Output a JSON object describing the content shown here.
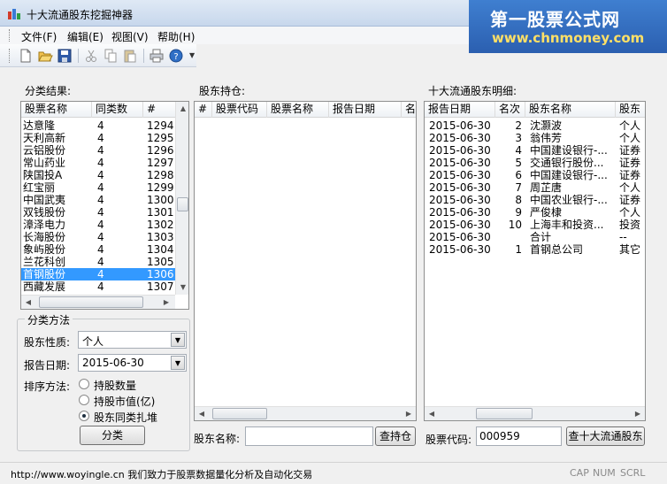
{
  "window": {
    "title": "十大流通股东挖掘神器"
  },
  "watermark": {
    "title": "第一股票公式网",
    "url": "www.chnmoney.com"
  },
  "menu": [
    "文件(F)",
    "编辑(E)",
    "视图(V)",
    "帮助(H)"
  ],
  "toolbar": {
    "icons": [
      "new-file-icon",
      "open-folder-icon",
      "save-icon",
      "cut-icon",
      "copy-icon",
      "paste-icon",
      "print-icon",
      "help-icon"
    ]
  },
  "classification": {
    "title": "分类结果:",
    "columns": [
      "股票名称",
      "同类数",
      "#"
    ],
    "rows": [
      [
        "达意隆",
        "4",
        "1294"
      ],
      [
        "天利高新",
        "4",
        "1295"
      ],
      [
        "云铝股份",
        "4",
        "1296"
      ],
      [
        "常山药业",
        "4",
        "1297"
      ],
      [
        "陕国投A",
        "4",
        "1298"
      ],
      [
        "红宝丽",
        "4",
        "1299"
      ],
      [
        "中国武夷",
        "4",
        "1300"
      ],
      [
        "双钱股份",
        "4",
        "1301"
      ],
      [
        "漳泽电力",
        "4",
        "1302"
      ],
      [
        "长海股份",
        "4",
        "1303"
      ],
      [
        "象屿股份",
        "4",
        "1304"
      ],
      [
        "兰花科创",
        "4",
        "1305"
      ],
      [
        "首钢股份",
        "4",
        "1306"
      ],
      [
        "西藏发展",
        "4",
        "1307"
      ]
    ],
    "selected_index": 12
  },
  "method": {
    "title": "分类方法",
    "nature_label": "股东性质:",
    "nature_value": "个人",
    "date_label": "报告日期:",
    "date_value": "2015-06-30",
    "sort_label": "排序方法:",
    "sort_options": [
      "持股数量",
      "持股市值(亿)",
      "股东同类扎堆"
    ],
    "sort_selected": 2,
    "classify_button": "分类"
  },
  "holdings": {
    "title": "股东持仓:",
    "columns": [
      "#",
      "股票代码",
      "股票名称",
      "报告日期",
      "名"
    ],
    "holder_label": "股东名称:",
    "holder_value": "",
    "query_button": "查持仓"
  },
  "top10": {
    "title": "十大流通股东明细:",
    "columns": [
      "报告日期",
      "名次",
      "股东名称",
      "股东"
    ],
    "rows": [
      [
        "2015-06-30",
        "2",
        "沈灏波",
        "个人"
      ],
      [
        "2015-06-30",
        "3",
        "翁伟芳",
        "个人"
      ],
      [
        "2015-06-30",
        "4",
        "中国建设银行-...",
        "证券"
      ],
      [
        "2015-06-30",
        "5",
        "交通银行股份...",
        "证券"
      ],
      [
        "2015-06-30",
        "6",
        "中国建设银行-...",
        "证券"
      ],
      [
        "2015-06-30",
        "7",
        "周芷唐",
        "个人"
      ],
      [
        "2015-06-30",
        "8",
        "中国农业银行-...",
        "证券"
      ],
      [
        "2015-06-30",
        "9",
        "严俊棣",
        "个人"
      ],
      [
        "2015-06-30",
        "10",
        "上海丰和投资...",
        "投资"
      ],
      [
        "2015-06-30",
        "",
        "合计",
        "--"
      ],
      [
        "2015-06-30",
        "1",
        "首钢总公司",
        "其它"
      ]
    ],
    "code_label": "股票代码:",
    "code_value": "000959",
    "query_button": "查十大流通股东"
  },
  "status": {
    "text": "http://www.woyingle.cn 我们致力于股票数据量化分析及自动化交易",
    "indicators": [
      "CAP",
      "NUM",
      "SCRL"
    ]
  },
  "colors": {
    "selection": "#3399ff",
    "watermark_bg": "#2b5fb0",
    "watermark_url": "#ffe066"
  }
}
